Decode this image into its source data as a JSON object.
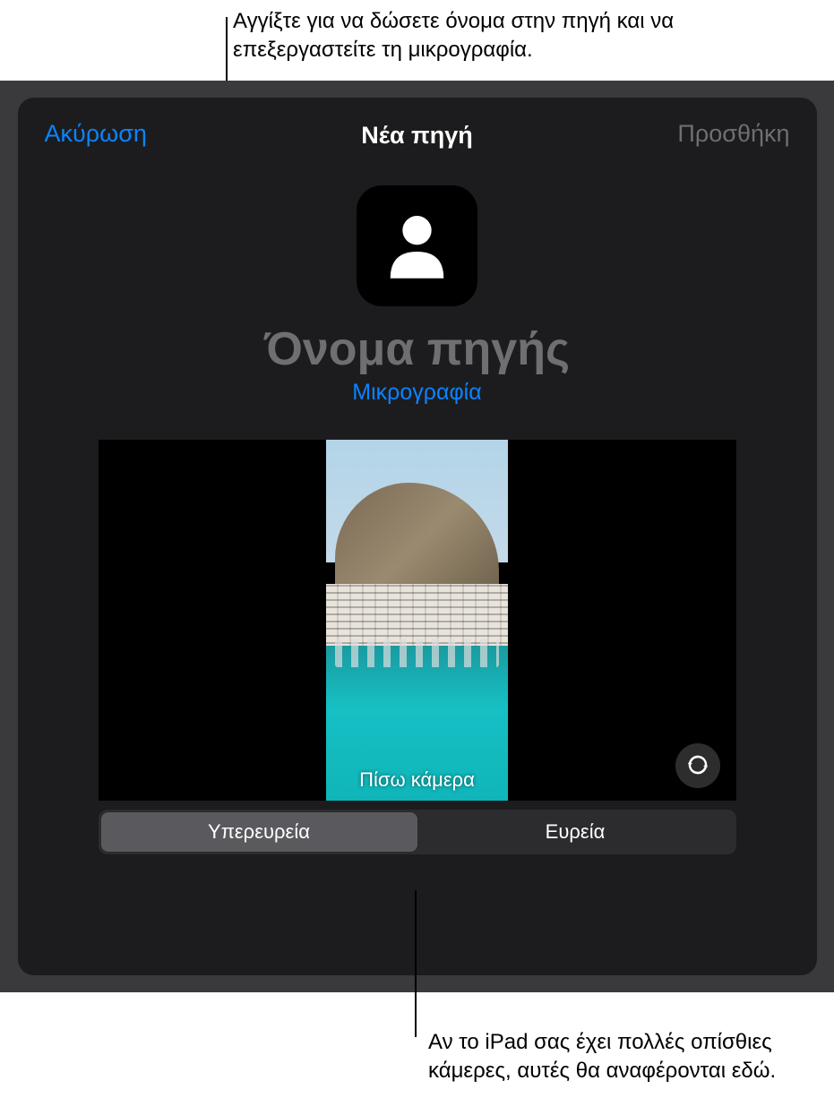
{
  "callouts": {
    "top": "Αγγίξτε για να δώσετε όνομα στην πηγή και να επεξεργαστείτε τη μικρογραφία.",
    "bottom": "Αν το iPad σας έχει πολλές οπίσθιες κάμερες, αυτές θα αναφέρονται εδώ."
  },
  "modal": {
    "cancel_label": "Ακύρωση",
    "title": "Νέα πηγή",
    "add_label": "Προσθήκη",
    "source_name_placeholder": "Όνομα πηγής",
    "thumbnail_link": "Μικρογραφία",
    "camera_label": "Πίσω κάμερα"
  },
  "segments": {
    "ultrawide": "Υπερευρεία",
    "wide": "Ευρεία"
  },
  "icons": {
    "avatar": "person-icon",
    "flip": "camera-flip-icon"
  }
}
